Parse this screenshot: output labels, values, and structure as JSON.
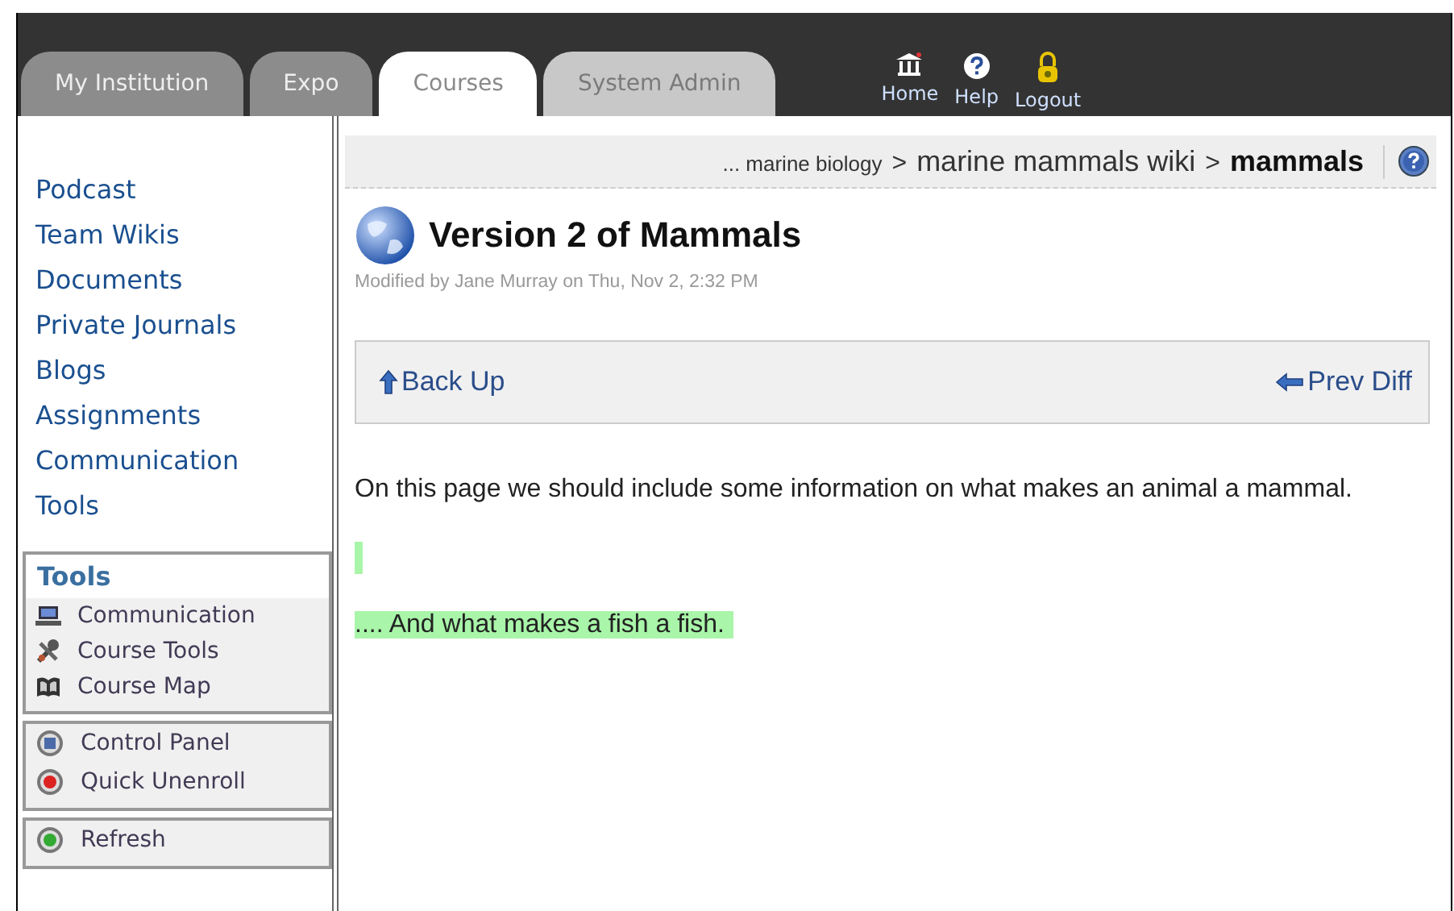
{
  "tabs": [
    {
      "label": "My Institution",
      "selected": false,
      "disabled": false
    },
    {
      "label": "Expo",
      "selected": false,
      "disabled": false
    },
    {
      "label": "Courses",
      "selected": true,
      "disabled": false
    },
    {
      "label": "System Admin",
      "selected": false,
      "disabled": true
    }
  ],
  "top_links": [
    {
      "label": "Home",
      "kind": "home"
    },
    {
      "label": "Help",
      "kind": "help"
    },
    {
      "label": "Logout",
      "kind": "logout"
    }
  ],
  "sidebar": {
    "items": [
      "Podcast",
      "Team Wikis",
      "Documents",
      "Private Journals",
      "Blogs",
      "Assignments",
      "Communication",
      "Tools"
    ],
    "tools_box": {
      "title": "Tools",
      "items": [
        {
          "label": "Communication",
          "kind": "computer"
        },
        {
          "label": "Course Tools",
          "kind": "tools"
        },
        {
          "label": "Course Map",
          "kind": "map"
        }
      ]
    },
    "panel_box": {
      "items": [
        {
          "label": "Control Panel",
          "kind": "panel"
        },
        {
          "label": "Quick Unenroll",
          "kind": "unenroll"
        }
      ]
    },
    "bottom_box": {
      "items": [
        {
          "label": "Refresh",
          "kind": "refresh"
        }
      ]
    }
  },
  "breadcrumb": [
    {
      "label": "... marine biology",
      "kind": "small"
    },
    {
      "label": ">",
      "kind": "separator"
    },
    {
      "label": "marine mammals wiki",
      "kind": "normal"
    },
    {
      "label": ">",
      "kind": "separator"
    },
    {
      "label": "mammals",
      "kind": "current"
    }
  ],
  "page": {
    "title": "Version 2 of Mammals",
    "modified": "Modified by Jane Murray on Thu, Nov 2, 2:32 PM",
    "nav": {
      "back": "Back Up",
      "prev": "Prev Diff"
    },
    "blocks": [
      {
        "kind": "text",
        "text": "On this page we should include some information on what makes an animal a mammal."
      },
      {
        "kind": "added-empty"
      },
      {
        "kind": "added",
        "text": ".... And what makes a fish a fish."
      }
    ]
  }
}
